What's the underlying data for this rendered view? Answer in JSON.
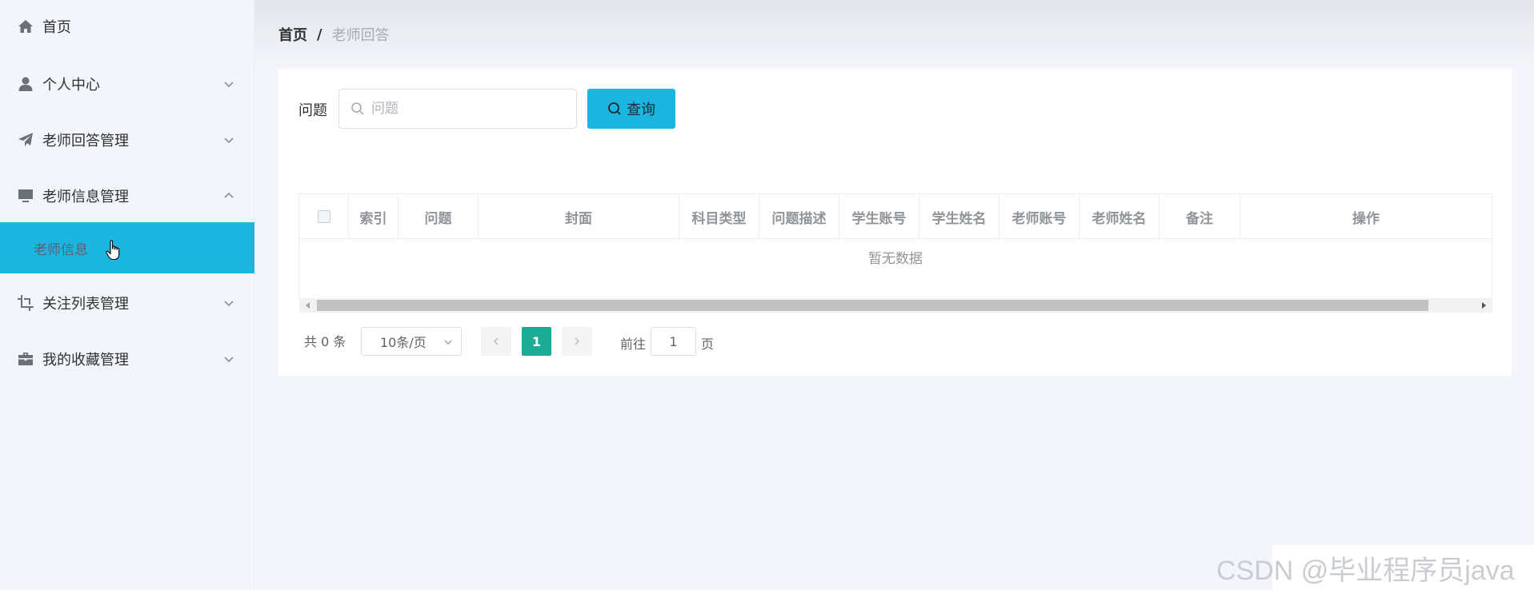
{
  "sidebar": {
    "items": [
      {
        "label": "首页",
        "icon": "home-icon"
      },
      {
        "label": "个人中心",
        "icon": "user-icon"
      },
      {
        "label": "老师回答管理",
        "icon": "send-icon"
      },
      {
        "label": "老师信息管理",
        "icon": "monitor-icon"
      },
      {
        "label": "关注列表管理",
        "icon": "crop-icon"
      },
      {
        "label": "我的收藏管理",
        "icon": "briefcase-icon"
      }
    ],
    "active_sub": "老师信息"
  },
  "breadcrumb": {
    "home": "首页",
    "separator": "/",
    "current": "老师回答"
  },
  "search": {
    "label": "问题",
    "placeholder": "问题",
    "button_label": "查询"
  },
  "table": {
    "columns": [
      "索引",
      "问题",
      "封面",
      "科目类型",
      "问题描述",
      "学生账号",
      "学生姓名",
      "老师账号",
      "老师姓名",
      "备注",
      "操作"
    ],
    "empty_text": "暂无数据"
  },
  "pagination": {
    "total_text": "共 0 条",
    "page_size": "10条/页",
    "current_page": "1",
    "goto_label": "前往",
    "goto_value": "1",
    "goto_suffix": "页"
  },
  "colors": {
    "accent": "#1cb5e0",
    "page_active": "#1cab97"
  },
  "watermark": "CSDN @毕业程序员java"
}
